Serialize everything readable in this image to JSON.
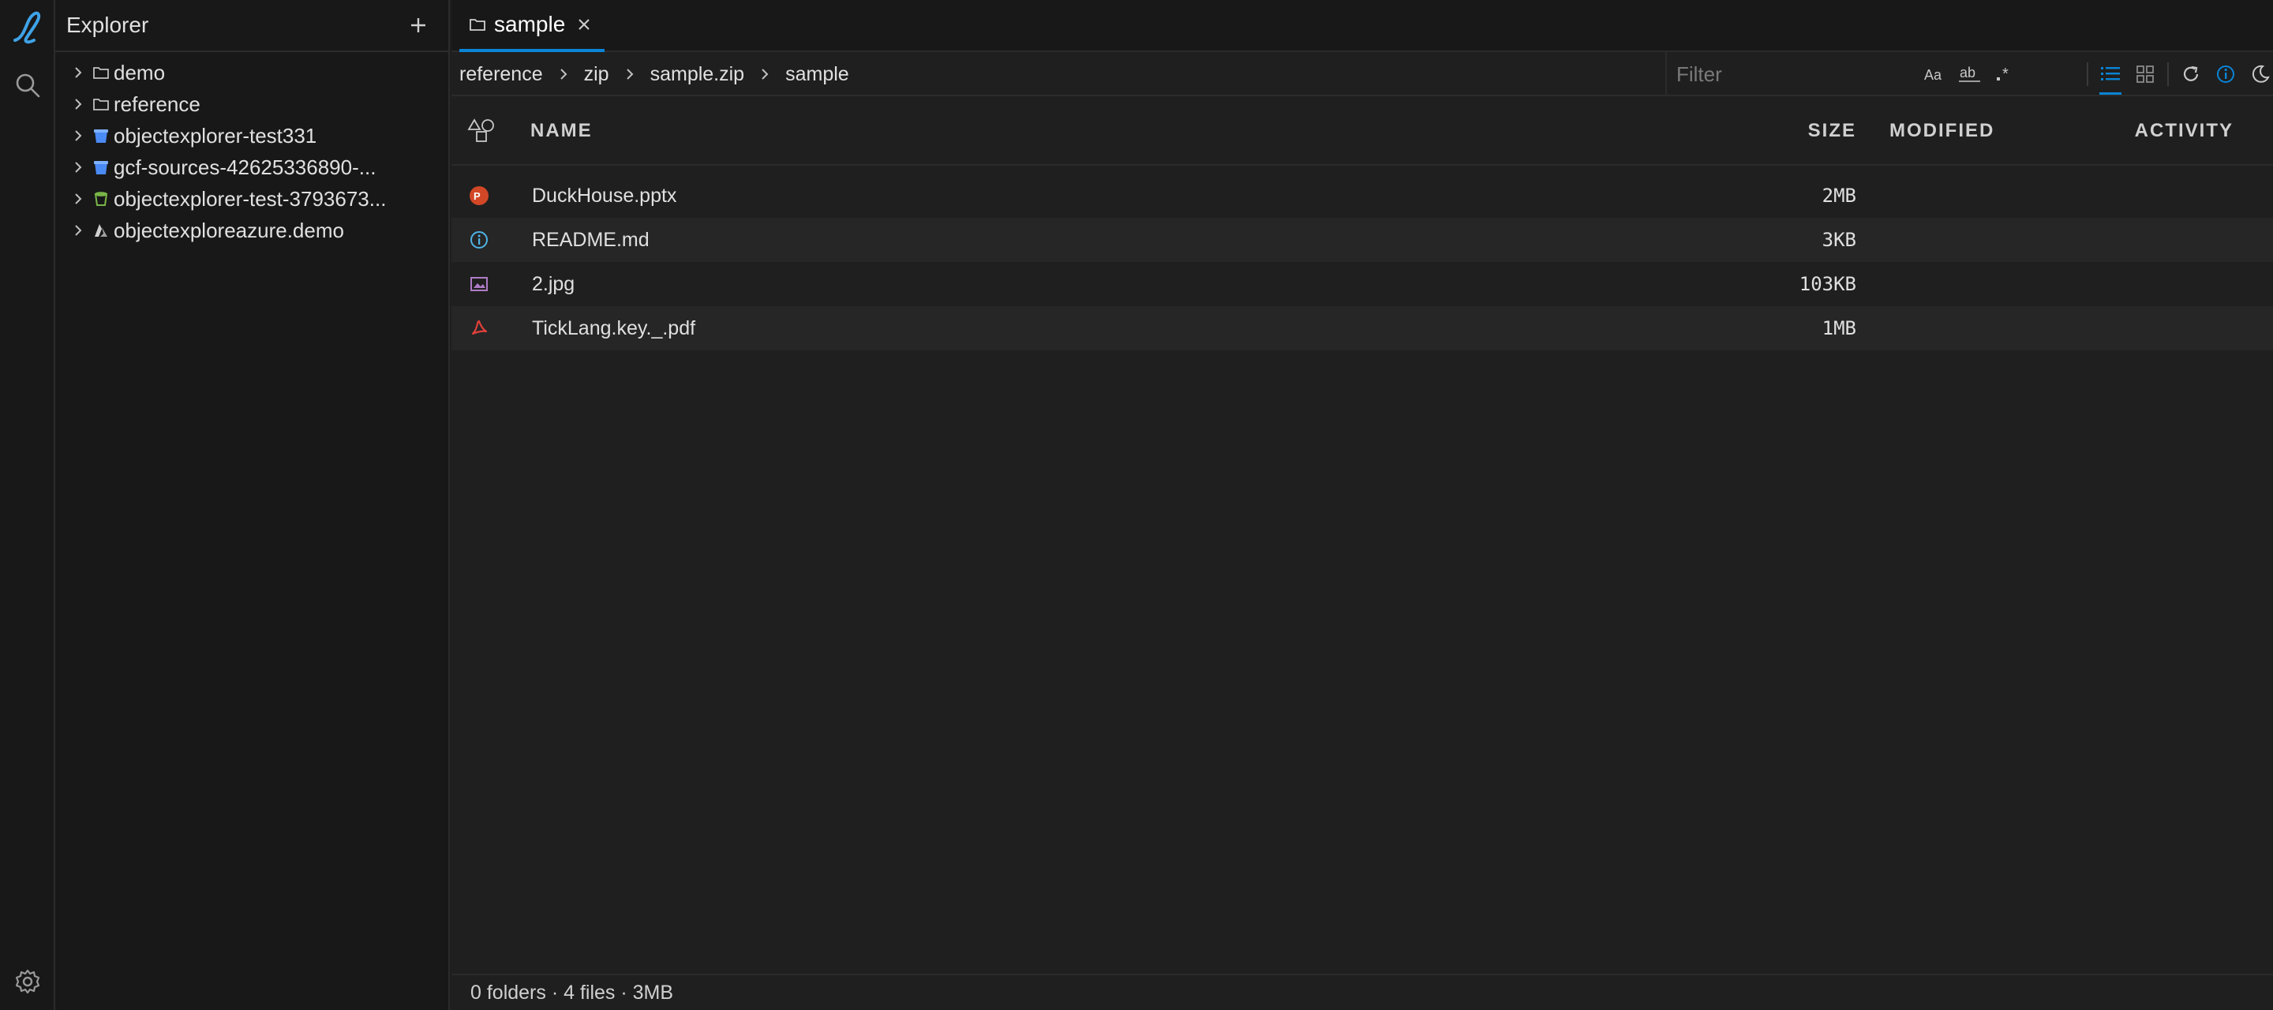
{
  "sidebar": {
    "title": "Explorer",
    "items": [
      {
        "label": "demo",
        "icon": "folder-icon"
      },
      {
        "label": "reference",
        "icon": "folder-icon"
      },
      {
        "label": "objectexplorer-test331",
        "icon": "gcs-bucket-icon"
      },
      {
        "label": "gcf-sources-42625336890-...",
        "icon": "gcs-bucket-icon"
      },
      {
        "label": "objectexplorer-test-3793673...",
        "icon": "s3-bucket-icon"
      },
      {
        "label": "objectexploreazure.demo",
        "icon": "azure-icon"
      }
    ]
  },
  "tab": {
    "label": "sample"
  },
  "breadcrumb": [
    "reference",
    "zip",
    "sample.zip",
    "sample"
  ],
  "filter": {
    "placeholder": "Filter"
  },
  "table": {
    "headers": {
      "name": "NAME",
      "size": "SIZE",
      "modified": "MODIFIED",
      "activity": "ACTIVITY"
    },
    "rows": [
      {
        "name": "DuckHouse.pptx",
        "size": "2MB",
        "icon": "pptx-icon"
      },
      {
        "name": "README.md",
        "size": "3KB",
        "icon": "info-icon"
      },
      {
        "name": "2.jpg",
        "size": "103KB",
        "icon": "image-icon"
      },
      {
        "name": "TickLang.key._.pdf",
        "size": "1MB",
        "icon": "pdf-icon"
      }
    ]
  },
  "status": {
    "text": "0 folders · 4 files · 3MB"
  },
  "colors": {
    "accent": "#0a84d6",
    "background": "#1f1f1f",
    "sidebar": "#181818"
  }
}
